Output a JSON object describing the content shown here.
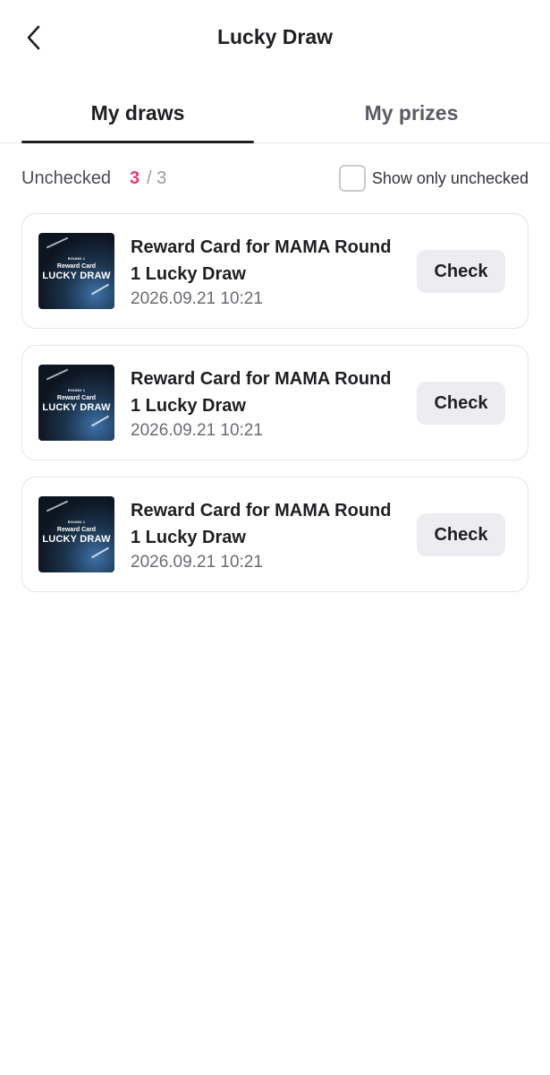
{
  "header": {
    "title": "Lucky Draw"
  },
  "tabs": [
    {
      "label": "My draws",
      "active": true
    },
    {
      "label": "My prizes",
      "active": false
    }
  ],
  "filter": {
    "label": "Unchecked",
    "count": "3",
    "separator_total": "/ 3",
    "show_only_label": "Show only unchecked",
    "show_only_checked": false
  },
  "colors": {
    "accent": "#e63a7a",
    "button_bg": "#ececf1",
    "text": "#1f1f23"
  },
  "draws": [
    {
      "title": "Reward Card for MAMA Round 1 Lucky Draw",
      "date": "2026.09.21 10:21",
      "button": "Check",
      "thumb": {
        "round": "ROUND 1",
        "line1": "Reward Card",
        "line2": "LUCKY DRAW"
      }
    },
    {
      "title": "Reward Card for MAMA Round 1 Lucky Draw",
      "date": "2026.09.21 10:21",
      "button": "Check",
      "thumb": {
        "round": "ROUND 1",
        "line1": "Reward Card",
        "line2": "LUCKY DRAW"
      }
    },
    {
      "title": "Reward Card for MAMA Round 1 Lucky Draw",
      "date": "2026.09.21 10:21",
      "button": "Check",
      "thumb": {
        "round": "ROUND 1",
        "line1": "Reward Card",
        "line2": "LUCKY DRAW"
      }
    }
  ]
}
